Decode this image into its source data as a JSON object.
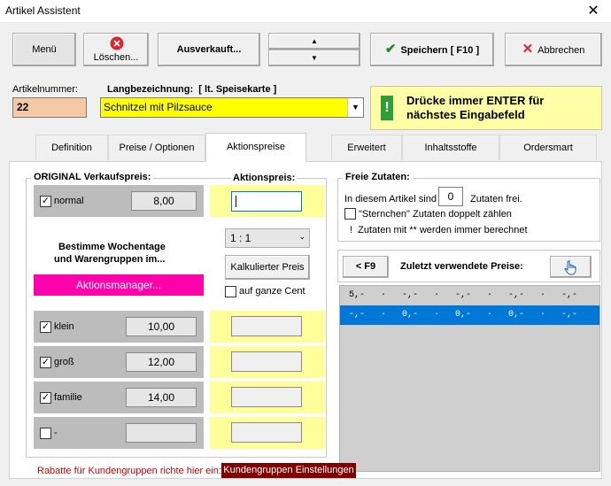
{
  "window": {
    "title": "Artikel Assistent",
    "close": "✕"
  },
  "toolbar": {
    "menu": "Menü",
    "delete": "Löschen...",
    "sold_out": "Ausverkauft...",
    "up": "▲",
    "down": "▼",
    "save": "Speichern [ F10 ]",
    "cancel": "Abbrechen"
  },
  "article": {
    "number_label": "Artikelnummer:",
    "number_value": "22",
    "desc_label": "Langbezeichnung:  [ lt. Speisekarte ]",
    "desc_value": "Schnitzel mit Pilzsauce"
  },
  "hint": {
    "line1": "Drücke immer ENTER für",
    "line2": "nächstes Eingabefeld",
    "icon": "!"
  },
  "tabs": [
    "Definition",
    "Preise / Optionen",
    "Aktionspreise",
    "Erweitert",
    "Inhaltsstoffe",
    "Ordersmart"
  ],
  "original": {
    "title": "ORIGINAL Verkaufspreis:",
    "rows": [
      {
        "label": "normal",
        "value": "8,00",
        "checked": true
      },
      {
        "label": "klein",
        "value": "10,00",
        "checked": true
      },
      {
        "label": "groß",
        "value": "12,00",
        "checked": true
      },
      {
        "label": "familie",
        "value": "14,00",
        "checked": true
      },
      {
        "label": "-",
        "value": "",
        "checked": false
      }
    ],
    "weekday_text1": "Bestimme Wochentage",
    "weekday_text2": "und Warengruppen im...",
    "manager_button": "Aktionsmanager..."
  },
  "action": {
    "title": "Aktionspreis:",
    "ratio": "1 : 1",
    "calc_button": "Kalkulierter Preis",
    "cent_label": "auf ganze Cent"
  },
  "extras": {
    "title": "Freie Zutaten:",
    "pre": "In diesem Artikel sind",
    "count": "0",
    "post": "Zutaten frei.",
    "stars_label": "\"Sternchen\" Zutaten doppelt zählen",
    "note": "!  Zutaten mit ** werden immer berechnet"
  },
  "recent": {
    "f9": "< F9",
    "title": "Zuletzt verwendete Preise:",
    "rows": [
      "5,-   ·   -,-   ·   -,-   ·   -,-   ·   -,-",
      "-,-   ·   0,-   ·   0,-   ·   0,-   ·   -,-"
    ]
  },
  "footer": {
    "text": "Rabatte für Kundengruppen richte hier ein:",
    "button": "Kundengruppen Einstellungen"
  }
}
